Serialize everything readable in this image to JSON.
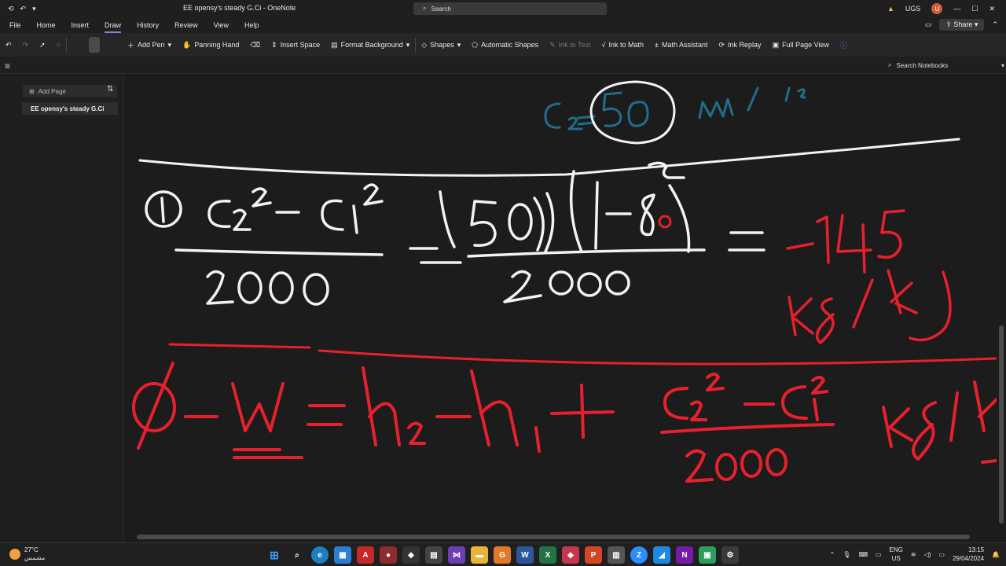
{
  "titlebar": {
    "title": "EE opensy's steady G.Ci - OneNote",
    "search_label": "Search",
    "user_initials": "UGS",
    "user_avatar": "U"
  },
  "menu": {
    "items": [
      "File",
      "Home",
      "Insert",
      "Draw",
      "History",
      "Review",
      "View",
      "Help"
    ],
    "active": "Draw",
    "share_label": "Share"
  },
  "ribbon": {
    "add_pen": "Add Pen",
    "panning_hand": "Panning Hand",
    "insert_space": "Insert Space",
    "format_background": "Format Background",
    "shapes": "Shapes",
    "automatic_shapes": "Automatic Shapes",
    "ink_to_text": "Ink to Text",
    "ink_to_math": "Ink to Math",
    "math_assistant": "Math Assistant",
    "ink_replay": "Ink Replay",
    "full_page_view": "Full Page View"
  },
  "sidebar": {
    "add_page": "Add Page",
    "pages": [
      "EE opensy's steady G.Ci"
    ]
  },
  "notebook_search": "Search Notebooks",
  "taskbar": {
    "temperature": "27°C",
    "weather_text": "مشمس",
    "lang_top": "ENG",
    "lang_bottom": "US",
    "time": "13:15",
    "date": "29/04/2024"
  },
  "colors": {
    "ink_white": "#f2f2f2",
    "ink_red": "#e8202e",
    "ink_blue": "#1f6e8a",
    "accent": "#a86fd6"
  }
}
